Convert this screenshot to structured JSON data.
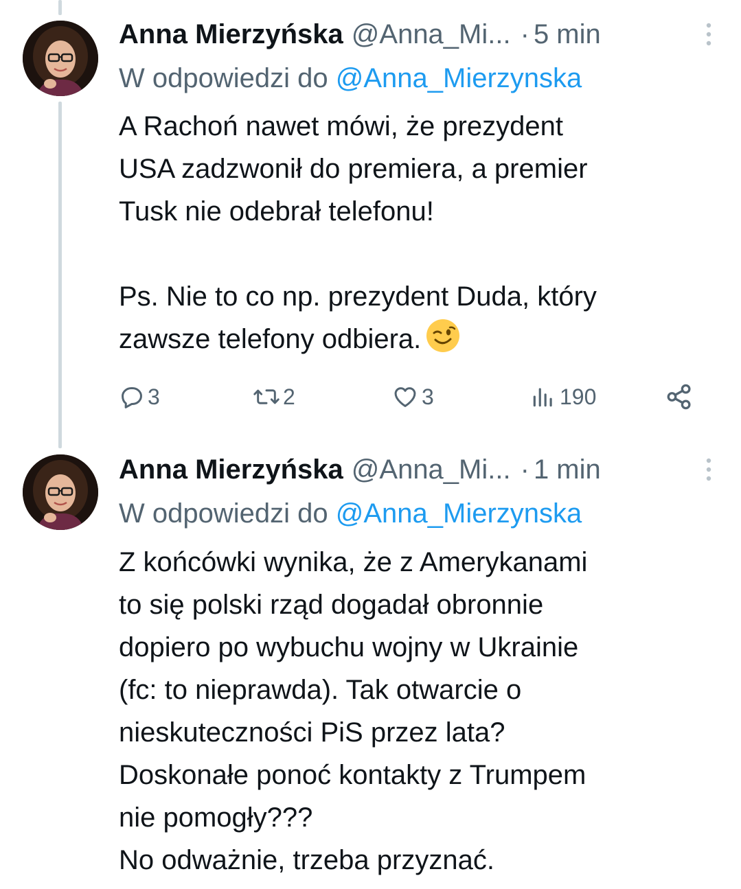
{
  "thread": {
    "tweets": [
      {
        "author_name": "Anna Mierzyńska",
        "author_handle": "@Anna_Mi...",
        "separator": "·",
        "time": "5 min",
        "reply_prefix": "W odpowiedzi do",
        "reply_mention": "@Anna_Mierzynska",
        "text_lines": [
          "A Rachoń nawet mówi, że prezydent",
          "USA zadzwonił do premiera, a premier",
          "Tusk nie odebrał telefonu!",
          "",
          "Ps. Nie to co np. prezydent Duda, który",
          "zawsze telefony odbiera."
        ],
        "emoji": "winking-face",
        "replies": "3",
        "reposts": "2",
        "likes": "3",
        "views": "190"
      },
      {
        "author_name": "Anna Mierzyńska",
        "author_handle": "@Anna_Mi...",
        "separator": "·",
        "time": "1 min",
        "reply_prefix": "W odpowiedzi do",
        "reply_mention": "@Anna_Mierzynska",
        "text_lines": [
          "Z końcówki wynika, że z Amerykanami",
          "to się polski rząd dogadał obronnie",
          "dopiero po wybuchu wojny w Ukrainie",
          "(fc: to nieprawda). Tak otwarcie o",
          "nieskuteczności PiS przez lata?",
          "Doskonałe ponoć kontakty z Trumpem",
          "nie pomogły???",
          "No odważnie, trzeba przyznać."
        ]
      }
    ]
  },
  "colors": {
    "text": "#0f1419",
    "secondary": "#536471",
    "link": "#1d9bf0",
    "thread_line": "#cfd9de"
  },
  "icons": {
    "reply": "speech-bubble-icon",
    "repost": "repost-arrows-icon",
    "like": "heart-icon",
    "views": "bar-chart-icon",
    "share": "share-nodes-icon",
    "more": "vertical-dots-icon"
  }
}
